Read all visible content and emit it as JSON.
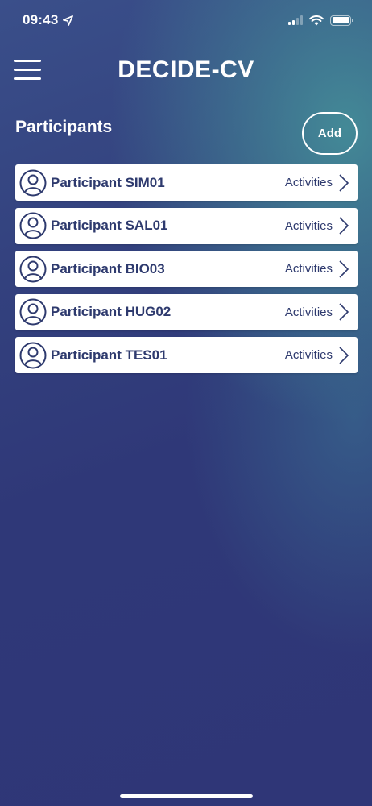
{
  "status_bar": {
    "time": "09:43",
    "icons": [
      "location-arrow-icon",
      "cellular-signal-icon",
      "wifi-icon",
      "battery-icon"
    ]
  },
  "header": {
    "title": "DECIDE-CV",
    "menu_icon": "hamburger-menu-icon"
  },
  "section": {
    "title": "Participants",
    "add_label": "Add"
  },
  "participants": [
    {
      "name": "Participant SIM01",
      "action": "Activities"
    },
    {
      "name": "Participant SAL01",
      "action": "Activities"
    },
    {
      "name": "Participant BIO03",
      "action": "Activities"
    },
    {
      "name": "Participant HUG02",
      "action": "Activities"
    },
    {
      "name": "Participant TES01",
      "action": "Activities"
    }
  ],
  "colors": {
    "accent_text": "#2e3a6e",
    "background_dark": "#2f3677",
    "background_teal": "#46969b",
    "card": "#ffffff"
  }
}
